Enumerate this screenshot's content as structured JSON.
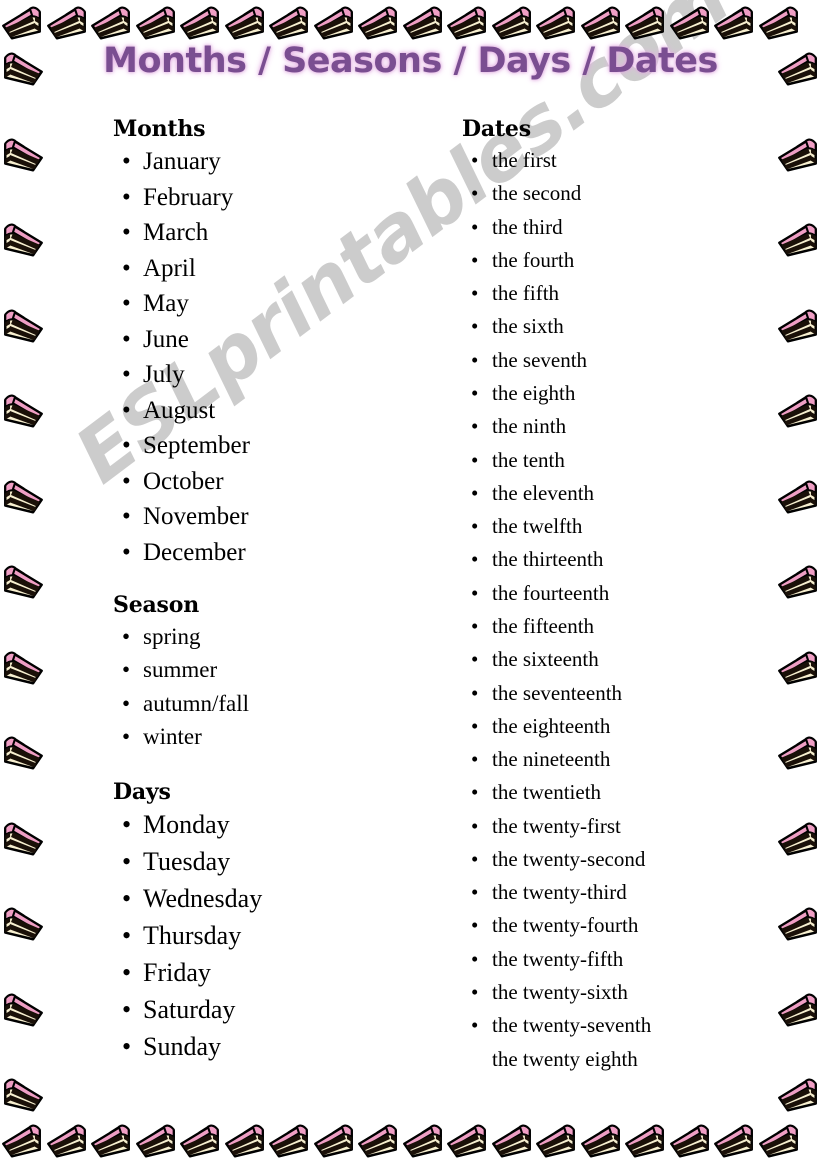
{
  "document": {
    "title": "Months / Seasons / Days  / Dates",
    "title_color": "#7a4e91",
    "watermark": "ESLprintables.com",
    "watermark_color": "#cccccc",
    "background_color": "#ffffff",
    "border_motif": "cake-slice"
  },
  "border": {
    "icon_name": "cake-slice-icon",
    "top_count": 18,
    "bottom_count": 18,
    "left_count": 13,
    "right_count": 13,
    "colors": {
      "frosting": "#ef9ec4",
      "sponge": "#f7efcf",
      "chocolate": "#1a1008",
      "outline": "#000000"
    }
  },
  "columns": {
    "left": {
      "sections": [
        {
          "id": "months",
          "heading": "Months",
          "bullet": "•",
          "items": [
            "January",
            "February",
            "March",
            "April",
            "May",
            "June",
            "July",
            "August",
            "September",
            "October",
            "November",
            "December"
          ]
        },
        {
          "id": "seasons",
          "heading": "Season",
          "bullet": "•",
          "items": [
            "spring",
            "summer",
            "autumn/fall",
            "winter"
          ]
        },
        {
          "id": "days",
          "heading": "Days",
          "bullet": "•",
          "items": [
            "Monday",
            "Tuesday",
            "Wednesday",
            "Thursday",
            "Friday",
            "Saturday",
            "Sunday"
          ]
        }
      ]
    },
    "right": {
      "sections": [
        {
          "id": "dates",
          "heading": "Dates",
          "bullet": "•",
          "items": [
            "the first",
            "the second",
            "the third",
            "the fourth",
            "the fifth",
            "the sixth",
            "the seventh",
            "the eighth",
            "the ninth",
            "the tenth",
            "the eleventh",
            "the twelfth",
            "the thirteenth",
            "the fourteenth",
            "the fifteenth",
            "the sixteenth",
            "the seventeenth",
            "the eighteenth",
            "the nineteenth",
            "the twentieth",
            "the twenty-first",
            "the twenty-second",
            "the twenty-third",
            "the twenty-fourth",
            "the twenty-fifth",
            "the twenty-sixth",
            "the twenty-seventh"
          ],
          "continuation_items": [
            "the twenty eighth"
          ]
        }
      ]
    }
  }
}
